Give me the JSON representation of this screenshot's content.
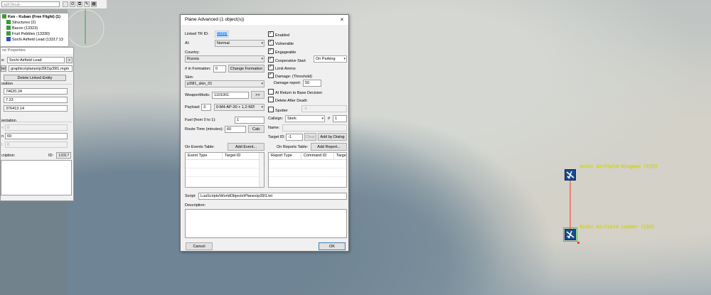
{
  "toolbar": {
    "combo_value": "ault Decal--"
  },
  "tree": {
    "items": [
      {
        "label": "Ken - Kuban (Free Flight) (1)",
        "bold": true
      },
      {
        "label": "Structures (2)"
      },
      {
        "label": "Bacon (13323)"
      },
      {
        "label": "Fruit Pebbles (13330)"
      },
      {
        "label": "Sochi Airfield Lead (13317:13"
      }
    ]
  },
  "props_panel": {
    "title": "ne Properties",
    "name_label": "e:",
    "name_value": "Sochi Airfield Lead",
    "name_btn": ">",
    "model_btn": "lel",
    "model_value": "graphics\\planes\\p39l1\\p39l1.mgm",
    "delete_btn": "Delete Linked Entity",
    "position_label": "osition",
    "pos_x": "74620.24",
    "pos_y": "7.23",
    "pos_z": "376413.14",
    "orientation_label": "ientation",
    "ori_1_label": "<:",
    "ori_1": "0",
    "ori_2_label": "n",
    "ori_2": "69",
    "ori_3_label": "l:",
    "ori_3": "0",
    "desc_label": "cription:",
    "id_label": "ID:",
    "id_value": "13317"
  },
  "dialog": {
    "title": "Plane Advanced (1 object(s))",
    "close": "×",
    "linked_tr_label": "Linked TR ID:",
    "linked_tr_value": "13318",
    "ai_label": "AI:",
    "ai_value": "Normal",
    "country_label": "Country:",
    "country_value": "Russia",
    "in_formation_label": "# in Formation:",
    "in_formation_value": "0",
    "change_formation_btn": "Change Formation",
    "skin_label": "Skin:",
    "skin_value": "p39l1_skin_01",
    "weaponmods_label": "WeaponMods:",
    "weaponmods_value": "1101001",
    "weaponmods_btn": ">>",
    "payload_label": "Payload:",
    "payload_value": "3",
    "payload_desc": "0-M4-AP-30 + 1,2-M2!",
    "fuel_label": "Fuel (from 0 to 1):",
    "fuel_value": "1",
    "route_time_label": "Route Time (minutes):",
    "route_time_value": "60",
    "calc_btn": "Calc",
    "on_events_label": "On Events Table:",
    "add_event_btn": "Add Event...",
    "events_cols": [
      "Event Type",
      "Target ID"
    ],
    "on_reports_label": "On Reports Table:",
    "add_report_btn": "Add Report...",
    "reports_cols": [
      "Report Type",
      "Command ID",
      "Targe"
    ],
    "enabled": "Enabled",
    "vulnerable": "Vulnerable",
    "engageable": "Engageable",
    "coop_start": "Cooperative Start",
    "coop_value": "On Parking",
    "limit_ammo": "Limit Ammo",
    "damage_threshold": "Damage: (Threshold)",
    "damage_report_label": "Damage report:",
    "damage_report_value": "50",
    "ai_return": "AI Return to Base Decision",
    "delete_after_death": "Delete After Death",
    "spotter": "Spotter",
    "spotter_value": "-1",
    "callsign_label": "Callsign:",
    "callsign_value": "Stork",
    "callsign_num_label": "#",
    "callsign_num": "1",
    "name_label": "Name:",
    "name_value": "",
    "target_id_label": "Target ID:",
    "target_id_value": "-1",
    "clear_btn": "Clear",
    "add_by_dialog_btn": "Add by Dialog",
    "script_label": "Script:",
    "script_value": "LuaScripts\\WorldObjects\\Planes\\p39l1.txt",
    "description_label": "Description:",
    "description_value": "",
    "cancel_btn": "Cancel",
    "ok_btn": "OK"
  },
  "map": {
    "marker1_label": "Sochi Airfield Wingman (1333",
    "marker2_label": "Sochi Airfield Leader (1331"
  }
}
